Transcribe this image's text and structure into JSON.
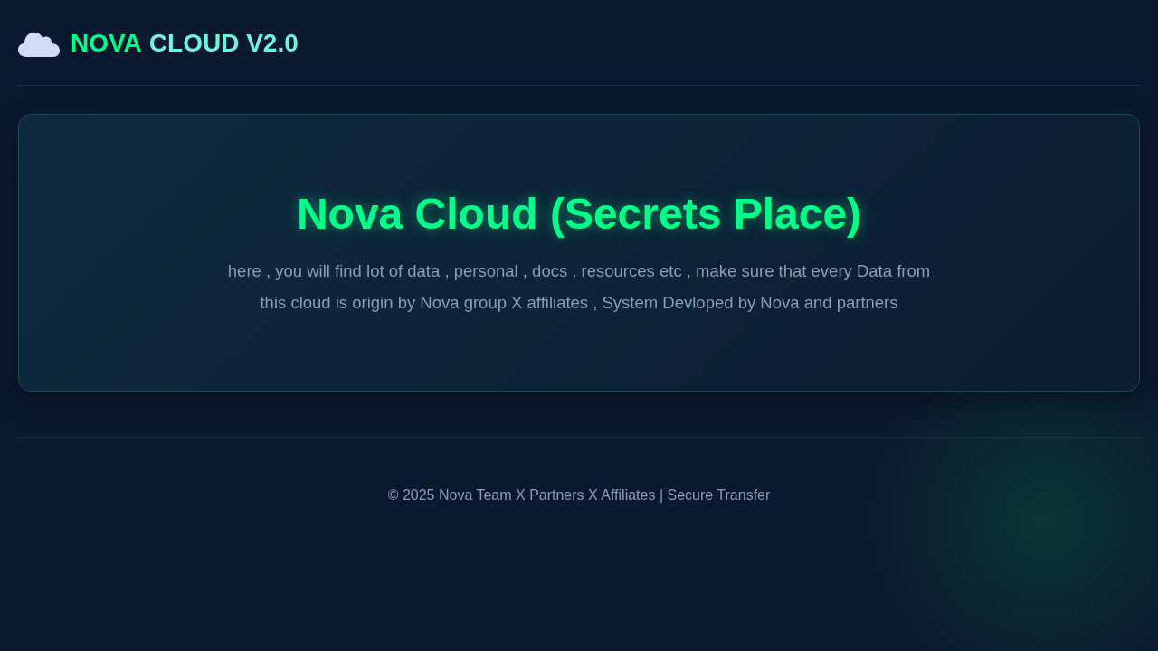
{
  "header": {
    "logo_parts": [
      {
        "text": "NOVA",
        "color": "#00ff88"
      },
      {
        "text": "CLOUD V2.0",
        "color": "#6ef5da"
      }
    ]
  },
  "hero": {
    "title": "Nova Cloud (Secrets Place)",
    "description": "here , you will find lot of data , personal , docs , resources etc , make sure that every Data from this cloud is origin by Nova group X affiliates , System Devloped by Nova and partners"
  },
  "footer": {
    "text": "© 2025 Nova Team X Partners X Affiliates | Secure Transfer"
  }
}
